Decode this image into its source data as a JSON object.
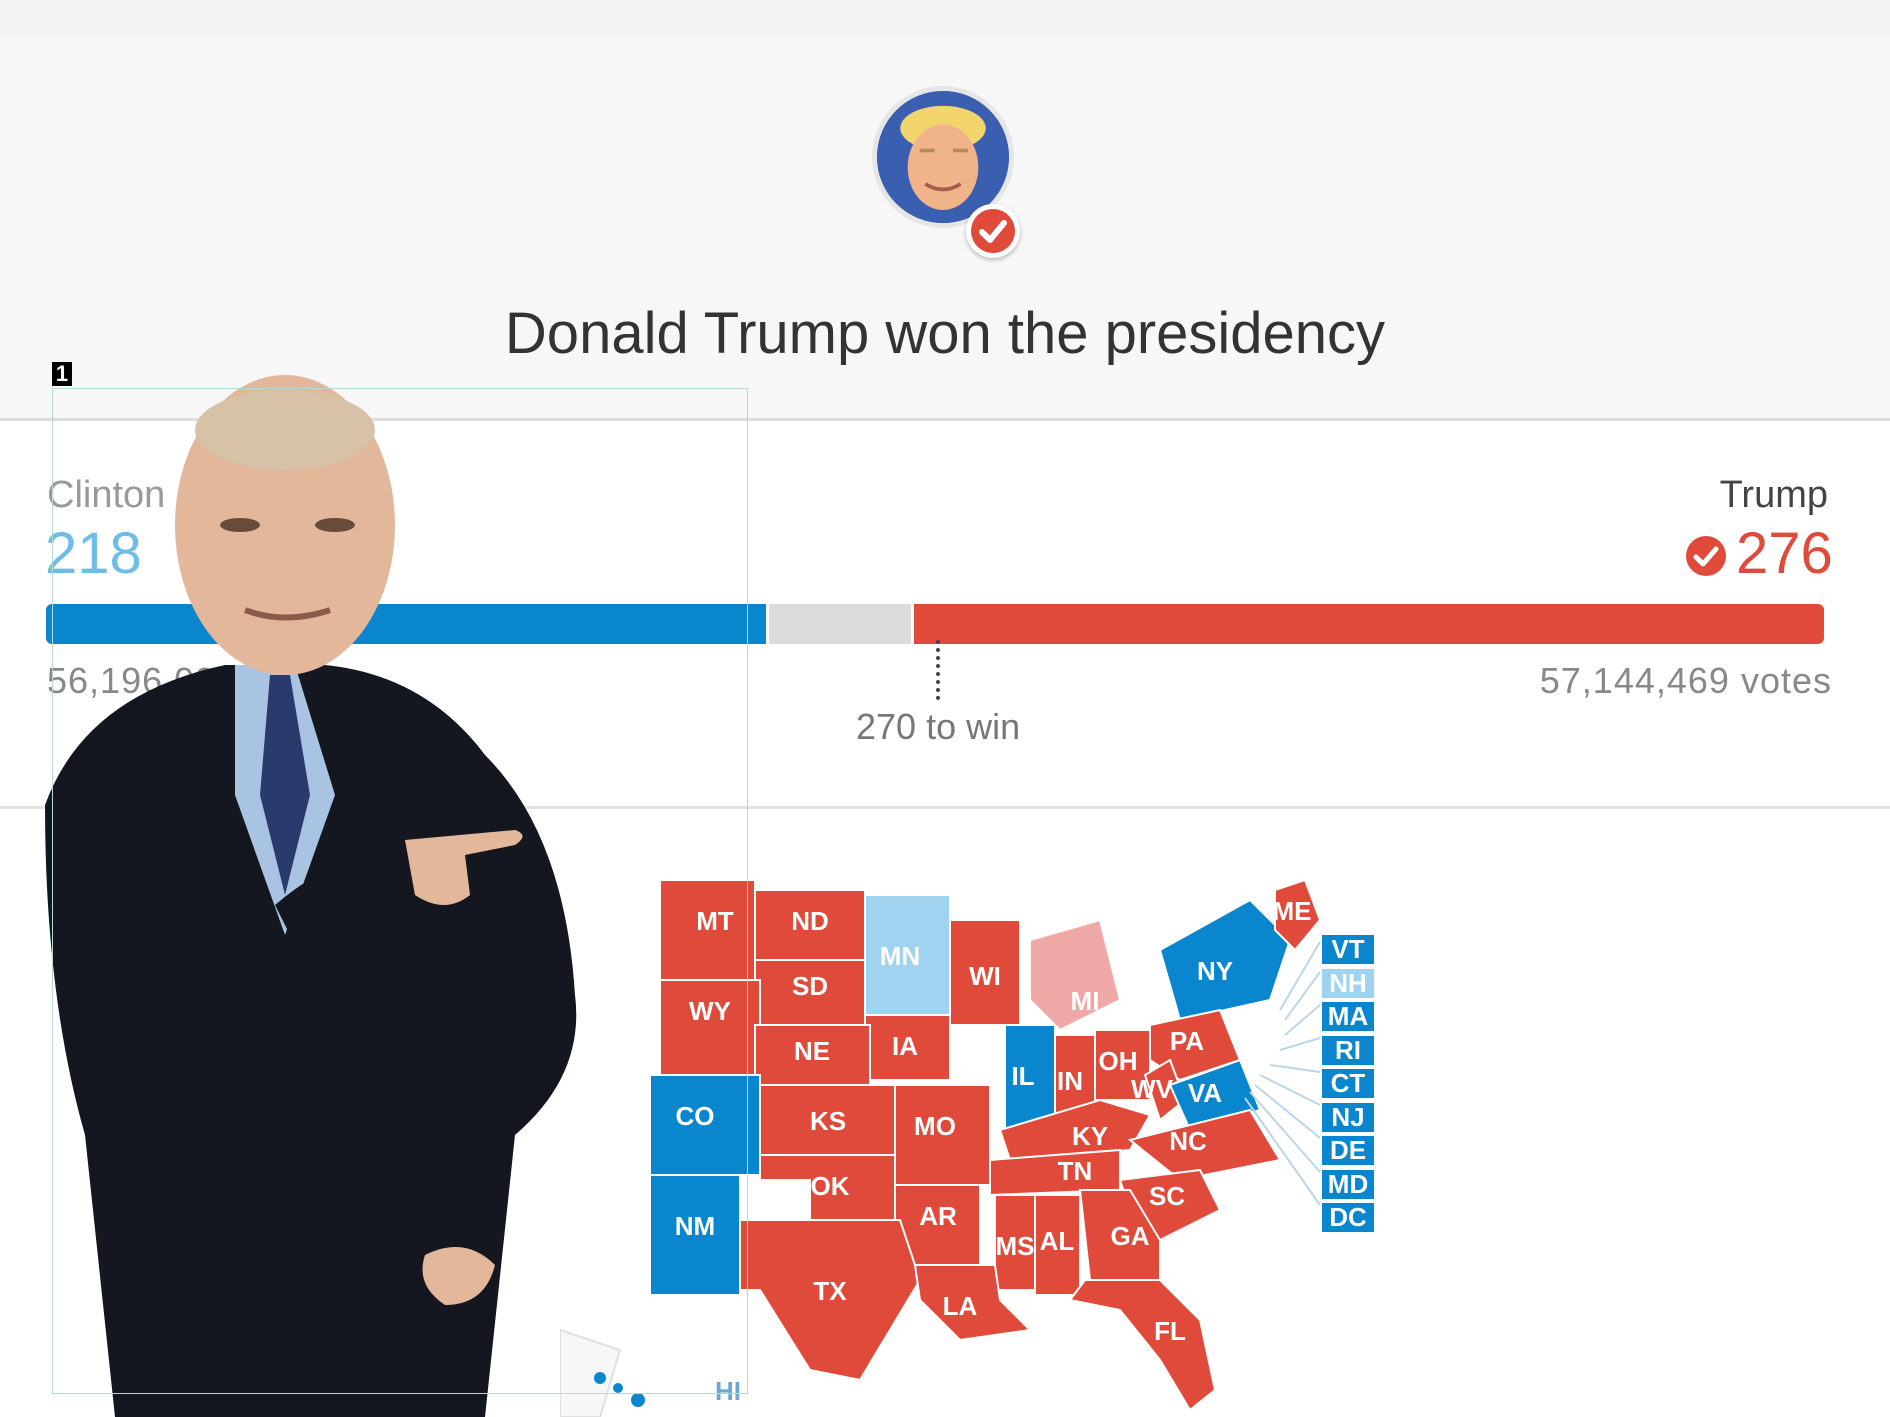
{
  "headline": "Donald Trump won the presidency",
  "colors": {
    "clinton": "#0a86cf",
    "trump": "#e04a3a",
    "undecided": "#dcdcdc",
    "clinton_light": "#9fd3ef",
    "trump_light": "#f0a8a6"
  },
  "icons": {
    "winner_check": "check-circle-icon"
  },
  "candidates": {
    "left": {
      "name": "Clinton",
      "electoral_votes": "218",
      "popular_votes": "56,196,09"
    },
    "right": {
      "name": "Trump",
      "electoral_votes": "276",
      "popular_votes": "57,144,469 votes"
    }
  },
  "bar": {
    "clinton_share": 0.405,
    "undecided_share": 0.08,
    "trump_share": 0.51,
    "threshold_label": "270 to win"
  },
  "map": {
    "states": [
      {
        "abbr": "MT",
        "party": "R"
      },
      {
        "abbr": "ND",
        "party": "R"
      },
      {
        "abbr": "MN",
        "party": "D-light"
      },
      {
        "abbr": "WI",
        "party": "R"
      },
      {
        "abbr": "MI",
        "party": "R-light"
      },
      {
        "abbr": "NY",
        "party": "D"
      },
      {
        "abbr": "ME",
        "party": "split"
      },
      {
        "abbr": "WY",
        "party": "R"
      },
      {
        "abbr": "SD",
        "party": "R"
      },
      {
        "abbr": "IA",
        "party": "R"
      },
      {
        "abbr": "PA",
        "party": "R"
      },
      {
        "abbr": "NE",
        "party": "R"
      },
      {
        "abbr": "IL",
        "party": "D"
      },
      {
        "abbr": "IN",
        "party": "R"
      },
      {
        "abbr": "OH",
        "party": "R"
      },
      {
        "abbr": "WV",
        "party": "R"
      },
      {
        "abbr": "VA",
        "party": "D"
      },
      {
        "abbr": "CO",
        "party": "D"
      },
      {
        "abbr": "KS",
        "party": "R"
      },
      {
        "abbr": "MO",
        "party": "R"
      },
      {
        "abbr": "KY",
        "party": "R"
      },
      {
        "abbr": "NC",
        "party": "R"
      },
      {
        "abbr": "TN",
        "party": "R"
      },
      {
        "abbr": "SC",
        "party": "R"
      },
      {
        "abbr": "NM",
        "party": "D"
      },
      {
        "abbr": "OK",
        "party": "R"
      },
      {
        "abbr": "AR",
        "party": "R"
      },
      {
        "abbr": "GA",
        "party": "R"
      },
      {
        "abbr": "MS",
        "party": "R"
      },
      {
        "abbr": "AL",
        "party": "R"
      },
      {
        "abbr": "TX",
        "party": "R"
      },
      {
        "abbr": "LA",
        "party": "R"
      },
      {
        "abbr": "FL",
        "party": "R"
      },
      {
        "abbr": "HI",
        "party": "D"
      }
    ],
    "small_states": [
      {
        "abbr": "VT",
        "party": "D"
      },
      {
        "abbr": "NH",
        "party": "D-light"
      },
      {
        "abbr": "MA",
        "party": "D"
      },
      {
        "abbr": "RI",
        "party": "D"
      },
      {
        "abbr": "CT",
        "party": "D"
      },
      {
        "abbr": "NJ",
        "party": "D"
      },
      {
        "abbr": "DE",
        "party": "D"
      },
      {
        "abbr": "MD",
        "party": "D"
      },
      {
        "abbr": "DC",
        "party": "D"
      }
    ]
  },
  "overlay": {
    "box_label": "1"
  }
}
